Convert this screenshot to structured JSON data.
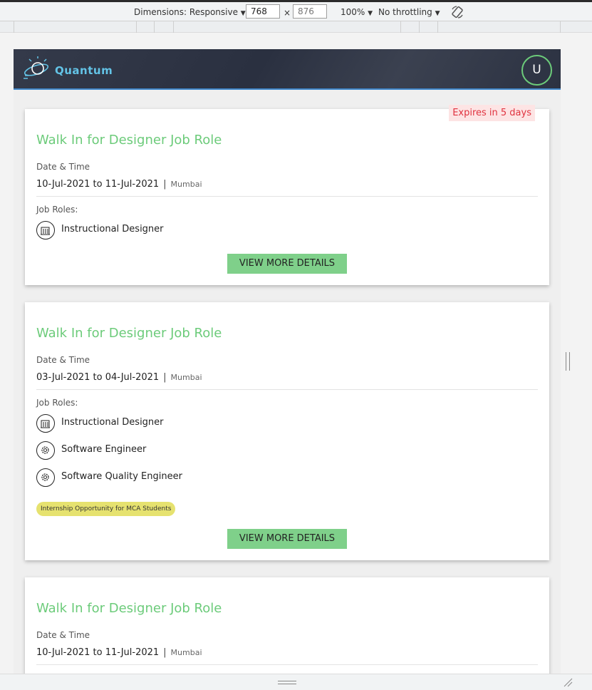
{
  "devtools": {
    "dimensions_label": "Dimensions: Responsive",
    "width_value": "768",
    "height_value": "876",
    "times": "×",
    "zoom": "100%",
    "throttling": "No throttling"
  },
  "app": {
    "brand": "Quantum",
    "avatar_initial": "U"
  },
  "cards": [
    {
      "expires": "Expires in 5 days",
      "title": "Walk In for Designer Job Role",
      "date_label": "Date & Time",
      "date_range": "10-Jul-2021 to 11-Jul-2021",
      "separator": "|",
      "location": "Mumbai",
      "roles_label": "Job Roles:",
      "roles": [
        "Instructional Designer"
      ],
      "button": "VIEW MORE DETAILS"
    },
    {
      "title": "Walk In for Designer Job Role",
      "date_label": "Date & Time",
      "date_range": "03-Jul-2021 to 04-Jul-2021",
      "separator": "|",
      "location": "Mumbai",
      "roles_label": "Job Roles:",
      "roles": [
        "Instructional Designer",
        "Software Engineer",
        "Software Quality Engineer"
      ],
      "badge": "Internship Opportunity for MCA Students",
      "button": "VIEW MORE DETAILS"
    },
    {
      "title": "Walk In for Designer Job Role",
      "date_label": "Date & Time",
      "date_range": "10-Jul-2021 to 11-Jul-2021",
      "separator": "|",
      "location": "Mumbai"
    }
  ],
  "colors": {
    "accent_green": "#6ccb7a",
    "button_green": "#7fd08a",
    "expires_red": "#e0323f",
    "badge_yellow": "#e6e26f",
    "header_dark": "#2f3545",
    "brand_blue": "#63c3e6"
  },
  "icons": {
    "designer_role": "building-icon",
    "engineer_role": "gear-icon",
    "rotate": "rotate-icon",
    "logo": "planet-bulb-logo"
  }
}
